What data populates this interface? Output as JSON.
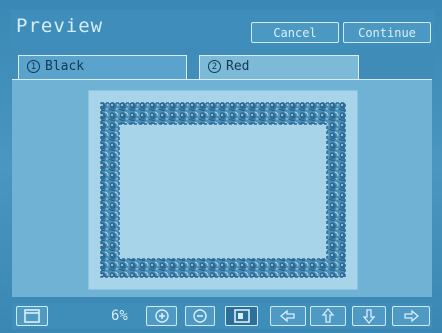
{
  "header": {
    "title": "Preview",
    "cancel_label": "Cancel",
    "continue_label": "Continue"
  },
  "tabs": [
    {
      "number": "1",
      "label": "Black",
      "selected": false
    },
    {
      "number": "2",
      "label": "Red",
      "selected": true
    }
  ],
  "toolbar": {
    "zoom_label": "6%",
    "icons": [
      "page-icon",
      "zoom-in-icon",
      "zoom-out-icon",
      "fit-page-icon",
      "pan-left-icon",
      "pan-up-icon",
      "pan-down-icon",
      "pan-right-icon"
    ]
  },
  "colors": {
    "background": "#3d8db8",
    "text": "#d8eff9",
    "paper": "#a8d4ea",
    "pattern": "#2f6f9a"
  }
}
